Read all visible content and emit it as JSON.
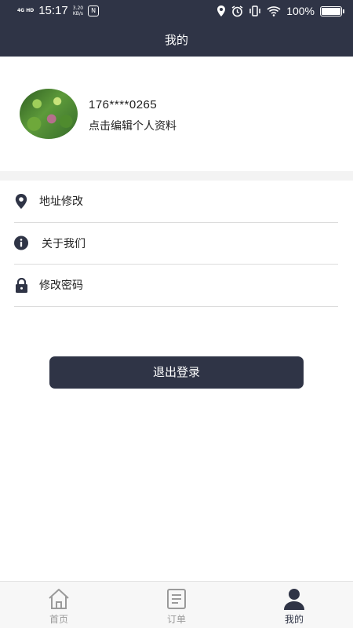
{
  "status_bar": {
    "network": "4G HD",
    "time": "15:17",
    "speed_value": "3.20",
    "speed_unit": "KB/s",
    "app_badge": "N",
    "battery": "100%"
  },
  "nav": {
    "title": "我的"
  },
  "profile": {
    "phone": "176****0265",
    "edit_hint": "点击编辑个人资料"
  },
  "menu": {
    "items": [
      {
        "label": "地址修改",
        "icon": "location-pin-icon"
      },
      {
        "label": "关于我们",
        "icon": "info-icon"
      },
      {
        "label": "修改密码",
        "icon": "lock-icon"
      }
    ]
  },
  "logout": {
    "label": "退出登录"
  },
  "tabbar": {
    "tabs": [
      {
        "label": "首页",
        "icon": "home-icon",
        "active": false
      },
      {
        "label": "订单",
        "icon": "order-list-icon",
        "active": false
      },
      {
        "label": "我的",
        "icon": "user-icon",
        "active": true
      }
    ]
  },
  "colors": {
    "primary": "#2f3446",
    "inactive": "#9a9a9a",
    "divider": "#dcdcdc"
  }
}
